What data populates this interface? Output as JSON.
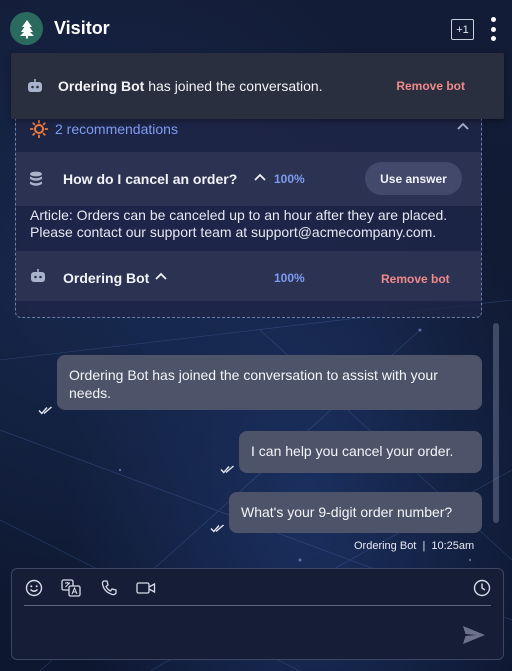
{
  "header": {
    "title": "Visitor",
    "badge": "+1",
    "avatar_icon": "tree-icon",
    "menu_icon": "kebab-menu-icon"
  },
  "toast": {
    "bot_name": "Ordering Bot",
    "message": " has joined the conversation.",
    "remove_label": "Remove bot"
  },
  "recommendations": {
    "count_label": "2 recommendations",
    "items": [
      {
        "title": "How do I cancel an order?",
        "confidence": "100%",
        "action_label": "Use answer",
        "article": "Article: Orders can be canceled up to an hour after they are placed. Please contact our support team at support@acmecompany.com."
      },
      {
        "title": "Ordering Bot",
        "confidence": "100%",
        "action_label": "Remove bot"
      }
    ]
  },
  "messages": [
    {
      "text": "Ordering Bot has joined the conversation to assist with your needs."
    },
    {
      "text": "I can help you cancel your order."
    },
    {
      "text": "What's your 9-digit order number?"
    }
  ],
  "last_meta": {
    "sender": "Ordering Bot",
    "separator": "|",
    "time": "10:25am"
  },
  "composer": {
    "placeholder": "",
    "tools": [
      "emoji-icon",
      "translate-icon",
      "phone-icon",
      "video-icon",
      "history-icon"
    ],
    "send_icon": "send-icon"
  },
  "colors": {
    "accent": "#7d9bf0",
    "danger": "#ef8a8a",
    "bubble": "#4d5469",
    "avatar": "#2b6a5e"
  }
}
